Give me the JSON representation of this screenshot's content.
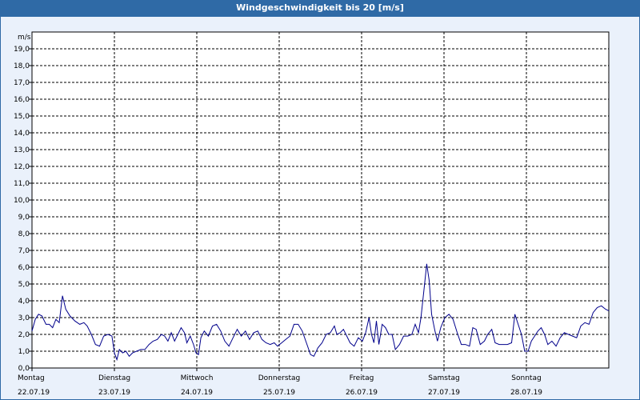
{
  "window": {
    "title": "Windgeschwindigkeit bis 20 [m/s]"
  },
  "chart_data": {
    "type": "line",
    "title": "Windgeschwindigkeit bis 20 [m/s]",
    "ylabel": "m/s",
    "ylim": [
      0,
      20
    ],
    "yticks": [
      "0,0",
      "1,0",
      "2,0",
      "3,0",
      "4,0",
      "5,0",
      "6,0",
      "7,0",
      "8,0",
      "9,0",
      "10,0",
      "11,0",
      "12,0",
      "13,0",
      "14,0",
      "15,0",
      "16,0",
      "17,0",
      "18,0",
      "19,0"
    ],
    "grid": true,
    "colors": {
      "line": "#00008b",
      "grid": "#000000",
      "plot_bg": "#ffffff",
      "titlebar": "#2f6aa6"
    },
    "x_categories": [
      {
        "day": "Montag",
        "date": "22.07.19"
      },
      {
        "day": "Dienstag",
        "date": "23.07.19"
      },
      {
        "day": "Mittwoch",
        "date": "24.07.19"
      },
      {
        "day": "Donnerstag",
        "date": "25.07.19"
      },
      {
        "day": "Freitag",
        "date": "26.07.19"
      },
      {
        "day": "Samstag",
        "date": "27.07.19"
      },
      {
        "day": "Sonntag",
        "date": "28.07.19"
      }
    ],
    "xlim_days": [
      0,
      7
    ],
    "series": [
      {
        "points": [
          [
            0.0,
            2.2
          ],
          [
            0.04,
            2.9
          ],
          [
            0.08,
            3.2
          ],
          [
            0.12,
            3.1
          ],
          [
            0.17,
            2.6
          ],
          [
            0.21,
            2.6
          ],
          [
            0.25,
            2.4
          ],
          [
            0.29,
            2.9
          ],
          [
            0.33,
            2.7
          ],
          [
            0.37,
            4.3
          ],
          [
            0.41,
            3.5
          ],
          [
            0.46,
            3.1
          ],
          [
            0.52,
            2.8
          ],
          [
            0.58,
            2.6
          ],
          [
            0.63,
            2.7
          ],
          [
            0.67,
            2.5
          ],
          [
            0.72,
            2.0
          ],
          [
            0.77,
            1.4
          ],
          [
            0.82,
            1.3
          ],
          [
            0.87,
            1.9
          ],
          [
            0.92,
            2.0
          ],
          [
            0.97,
            1.9
          ],
          [
            1.0,
            0.9
          ],
          [
            1.03,
            0.5
          ],
          [
            1.06,
            1.1
          ],
          [
            1.1,
            0.9
          ],
          [
            1.14,
            1.0
          ],
          [
            1.18,
            0.7
          ],
          [
            1.22,
            0.9
          ],
          [
            1.27,
            1.0
          ],
          [
            1.32,
            1.1
          ],
          [
            1.37,
            1.1
          ],
          [
            1.42,
            1.4
          ],
          [
            1.47,
            1.6
          ],
          [
            1.52,
            1.7
          ],
          [
            1.57,
            2.0
          ],
          [
            1.61,
            1.9
          ],
          [
            1.65,
            1.6
          ],
          [
            1.69,
            2.1
          ],
          [
            1.73,
            1.6
          ],
          [
            1.77,
            2.0
          ],
          [
            1.81,
            2.4
          ],
          [
            1.85,
            2.1
          ],
          [
            1.88,
            1.5
          ],
          [
            1.92,
            1.9
          ],
          [
            1.96,
            1.4
          ],
          [
            1.99,
            0.9
          ],
          [
            2.02,
            0.8
          ],
          [
            2.05,
            1.8
          ],
          [
            2.09,
            2.2
          ],
          [
            2.14,
            1.9
          ],
          [
            2.19,
            2.5
          ],
          [
            2.24,
            2.6
          ],
          [
            2.29,
            2.2
          ],
          [
            2.34,
            1.6
          ],
          [
            2.39,
            1.3
          ],
          [
            2.44,
            1.8
          ],
          [
            2.49,
            2.3
          ],
          [
            2.54,
            1.9
          ],
          [
            2.59,
            2.2
          ],
          [
            2.64,
            1.7
          ],
          [
            2.69,
            2.1
          ],
          [
            2.74,
            2.2
          ],
          [
            2.79,
            1.7
          ],
          [
            2.84,
            1.5
          ],
          [
            2.89,
            1.4
          ],
          [
            2.94,
            1.5
          ],
          [
            2.98,
            1.3
          ],
          [
            3.03,
            1.5
          ],
          [
            3.08,
            1.7
          ],
          [
            3.13,
            1.9
          ],
          [
            3.18,
            2.6
          ],
          [
            3.23,
            2.6
          ],
          [
            3.28,
            2.2
          ],
          [
            3.33,
            1.5
          ],
          [
            3.38,
            0.8
          ],
          [
            3.42,
            0.7
          ],
          [
            3.47,
            1.2
          ],
          [
            3.52,
            1.5
          ],
          [
            3.57,
            2.0
          ],
          [
            3.62,
            2.1
          ],
          [
            3.67,
            2.5
          ],
          [
            3.7,
            2.0
          ],
          [
            3.74,
            2.1
          ],
          [
            3.78,
            2.3
          ],
          [
            3.82,
            1.9
          ],
          [
            3.86,
            1.5
          ],
          [
            3.91,
            1.3
          ],
          [
            3.96,
            1.8
          ],
          [
            4.01,
            1.6
          ],
          [
            4.05,
            2.1
          ],
          [
            4.09,
            3.0
          ],
          [
            4.12,
            2.0
          ],
          [
            4.15,
            1.5
          ],
          [
            4.18,
            2.8
          ],
          [
            4.21,
            1.4
          ],
          [
            4.25,
            2.6
          ],
          [
            4.29,
            2.4
          ],
          [
            4.33,
            2.0
          ],
          [
            4.37,
            2.0
          ],
          [
            4.41,
            1.1
          ],
          [
            4.46,
            1.4
          ],
          [
            4.51,
            1.9
          ],
          [
            4.56,
            1.9
          ],
          [
            4.61,
            2.0
          ],
          [
            4.65,
            2.6
          ],
          [
            4.69,
            2.1
          ],
          [
            4.72,
            3.0
          ],
          [
            4.76,
            4.8
          ],
          [
            4.79,
            6.2
          ],
          [
            4.82,
            5.2
          ],
          [
            4.85,
            3.2
          ],
          [
            4.89,
            2.2
          ],
          [
            4.92,
            1.6
          ],
          [
            4.96,
            2.4
          ],
          [
            5.01,
            3.0
          ],
          [
            5.06,
            3.2
          ],
          [
            5.11,
            2.9
          ],
          [
            5.16,
            2.1
          ],
          [
            5.21,
            1.4
          ],
          [
            5.26,
            1.4
          ],
          [
            5.31,
            1.3
          ],
          [
            5.35,
            2.4
          ],
          [
            5.39,
            2.3
          ],
          [
            5.44,
            1.4
          ],
          [
            5.49,
            1.6
          ],
          [
            5.53,
            2.0
          ],
          [
            5.58,
            2.3
          ],
          [
            5.62,
            1.5
          ],
          [
            5.67,
            1.4
          ],
          [
            5.72,
            1.4
          ],
          [
            5.77,
            1.4
          ],
          [
            5.82,
            1.5
          ],
          [
            5.86,
            3.2
          ],
          [
            5.9,
            2.6
          ],
          [
            5.94,
            2.0
          ],
          [
            5.98,
            1.0
          ],
          [
            6.02,
            1.0
          ],
          [
            6.06,
            1.6
          ],
          [
            6.1,
            1.9
          ],
          [
            6.14,
            2.2
          ],
          [
            6.18,
            2.4
          ],
          [
            6.22,
            2.0
          ],
          [
            6.26,
            1.4
          ],
          [
            6.31,
            1.6
          ],
          [
            6.36,
            1.3
          ],
          [
            6.41,
            1.8
          ],
          [
            6.46,
            2.1
          ],
          [
            6.51,
            2.0
          ],
          [
            6.56,
            1.9
          ],
          [
            6.61,
            1.8
          ],
          [
            6.66,
            2.5
          ],
          [
            6.71,
            2.7
          ],
          [
            6.76,
            2.6
          ],
          [
            6.81,
            3.3
          ],
          [
            6.86,
            3.6
          ],
          [
            6.91,
            3.7
          ],
          [
            6.96,
            3.5
          ],
          [
            7.0,
            3.4
          ]
        ]
      }
    ]
  }
}
